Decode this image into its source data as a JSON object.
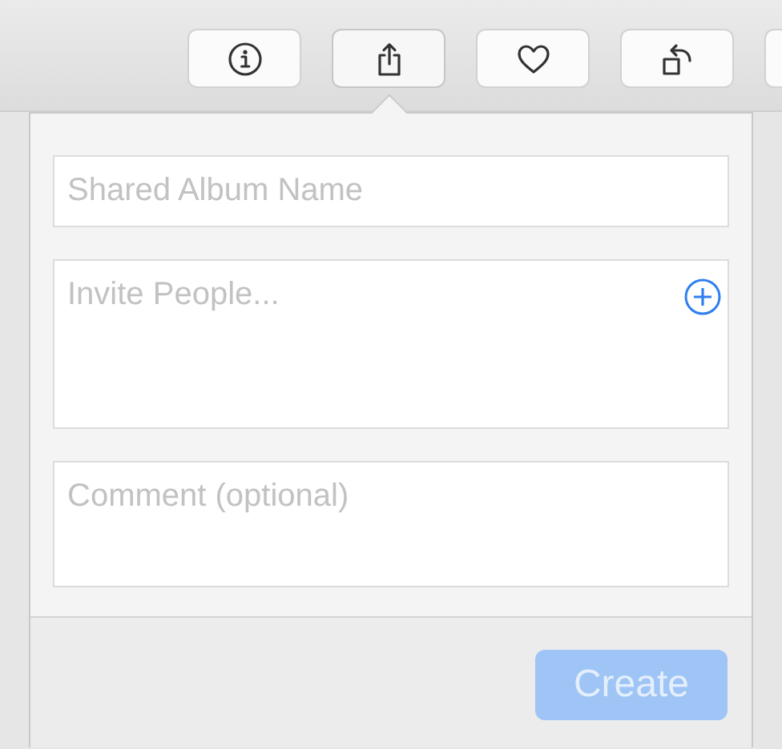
{
  "toolbar": {
    "buttons": [
      {
        "kind": "info",
        "selected": false
      },
      {
        "kind": "share",
        "selected": true
      },
      {
        "kind": "favorite",
        "selected": false
      },
      {
        "kind": "rotate",
        "selected": false
      },
      {
        "kind": "cut_off",
        "selected": false
      }
    ]
  },
  "shared_album_popover": {
    "fields": [
      {
        "kind": "line",
        "placeholder": "Shared Album Name"
      },
      {
        "kind": "invite",
        "placeholder": "Invite People..."
      },
      {
        "kind": "comment",
        "placeholder": "Comment (optional)"
      }
    ],
    "create_button": {
      "label": "Create",
      "disabled": true
    }
  }
}
